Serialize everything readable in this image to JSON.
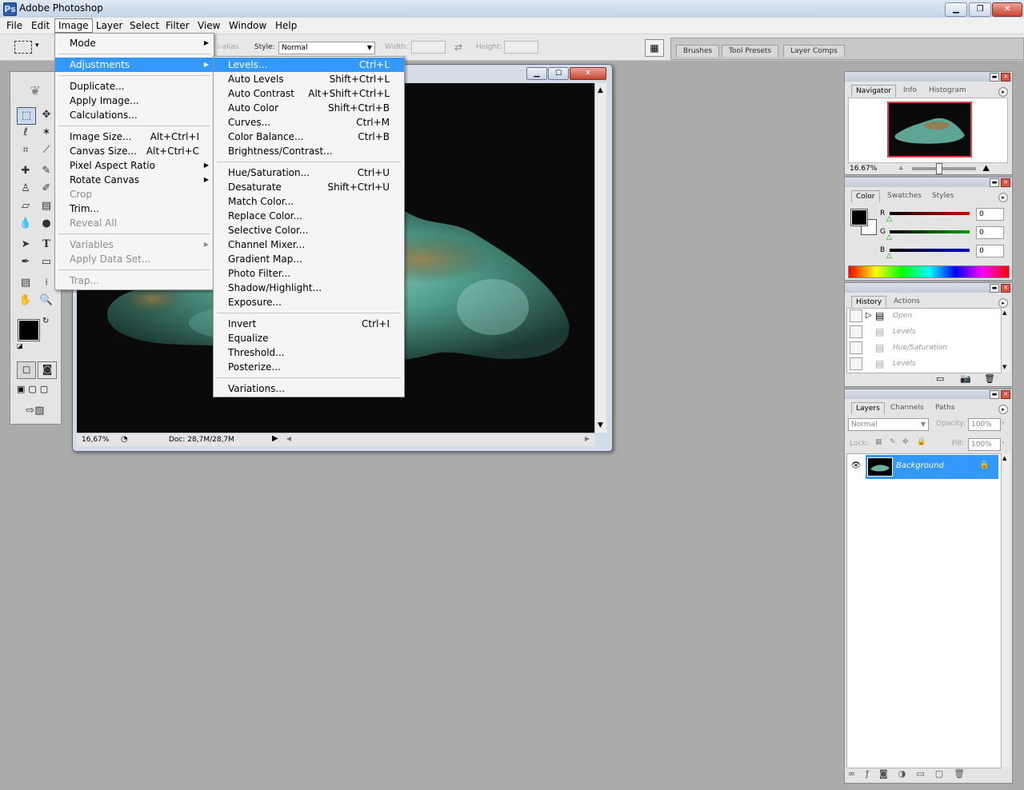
{
  "app": {
    "title": "Adobe Photoshop"
  },
  "menubar": [
    "File",
    "Edit",
    "Image",
    "Layer",
    "Select",
    "Filter",
    "View",
    "Window",
    "Help"
  ],
  "options_bar": {
    "antialias_fragment": "i-alias",
    "style_label": "Style:",
    "style_value": "Normal",
    "width_label": "Width:",
    "height_label": "Height:",
    "tabs": [
      "Brushes",
      "Tool Presets",
      "Layer Comps"
    ]
  },
  "image_menu": [
    {
      "label": "Mode",
      "shortcut": "",
      "submenu": true,
      "disabled": false
    },
    {
      "sep": true
    },
    {
      "label": "Adjustments",
      "shortcut": "",
      "submenu": true,
      "disabled": false,
      "highlight": true
    },
    {
      "sep": true
    },
    {
      "label": "Duplicate...",
      "shortcut": ""
    },
    {
      "label": "Apply Image...",
      "shortcut": ""
    },
    {
      "label": "Calculations...",
      "shortcut": ""
    },
    {
      "sep": true
    },
    {
      "label": "Image Size...",
      "shortcut": "Alt+Ctrl+I"
    },
    {
      "label": "Canvas Size...",
      "shortcut": "Alt+Ctrl+C"
    },
    {
      "label": "Pixel Aspect Ratio",
      "shortcut": "",
      "submenu": true
    },
    {
      "label": "Rotate Canvas",
      "shortcut": "",
      "submenu": true
    },
    {
      "label": "Crop",
      "shortcut": "",
      "disabled": true
    },
    {
      "label": "Trim...",
      "shortcut": ""
    },
    {
      "label": "Reveal All",
      "shortcut": "",
      "disabled": true
    },
    {
      "sep": true
    },
    {
      "label": "Variables",
      "shortcut": "",
      "submenu": true,
      "disabled": true
    },
    {
      "label": "Apply Data Set...",
      "shortcut": "",
      "disabled": true
    },
    {
      "sep": true
    },
    {
      "label": "Trap...",
      "shortcut": "",
      "disabled": true
    }
  ],
  "adjustments_menu": [
    {
      "label": "Levels...",
      "shortcut": "Ctrl+L",
      "highlight": true
    },
    {
      "label": "Auto Levels",
      "shortcut": "Shift+Ctrl+L"
    },
    {
      "label": "Auto Contrast",
      "shortcut": "Alt+Shift+Ctrl+L"
    },
    {
      "label": "Auto Color",
      "shortcut": "Shift+Ctrl+B"
    },
    {
      "label": "Curves...",
      "shortcut": "Ctrl+M"
    },
    {
      "label": "Color Balance...",
      "shortcut": "Ctrl+B"
    },
    {
      "label": "Brightness/Contrast...",
      "shortcut": ""
    },
    {
      "sep": true
    },
    {
      "label": "Hue/Saturation...",
      "shortcut": "Ctrl+U"
    },
    {
      "label": "Desaturate",
      "shortcut": "Shift+Ctrl+U"
    },
    {
      "label": "Match Color...",
      "shortcut": ""
    },
    {
      "label": "Replace Color...",
      "shortcut": ""
    },
    {
      "label": "Selective Color...",
      "shortcut": ""
    },
    {
      "label": "Channel Mixer...",
      "shortcut": ""
    },
    {
      "label": "Gradient Map...",
      "shortcut": ""
    },
    {
      "label": "Photo Filter...",
      "shortcut": ""
    },
    {
      "label": "Shadow/Highlight...",
      "shortcut": ""
    },
    {
      "label": "Exposure...",
      "shortcut": ""
    },
    {
      "sep": true
    },
    {
      "label": "Invert",
      "shortcut": "Ctrl+I"
    },
    {
      "label": "Equalize",
      "shortcut": ""
    },
    {
      "label": "Threshold...",
      "shortcut": ""
    },
    {
      "label": "Posterize...",
      "shortcut": ""
    },
    {
      "sep": true
    },
    {
      "label": "Variations...",
      "shortcut": ""
    }
  ],
  "document": {
    "zoom": "16,67%",
    "doc_info": "Doc: 28,7M/28,7M"
  },
  "navigator_panel": {
    "tabs": [
      "Navigator",
      "Info",
      "Histogram"
    ],
    "zoom": "16.67%"
  },
  "color_panel": {
    "tabs": [
      "Color",
      "Swatches",
      "Styles"
    ],
    "channels": [
      {
        "name": "R",
        "value": "0",
        "color": "#d40000"
      },
      {
        "name": "G",
        "value": "0",
        "color": "#00a000"
      },
      {
        "name": "B",
        "value": "0",
        "color": "#0000c8"
      }
    ]
  },
  "history_panel": {
    "tabs": [
      "History",
      "Actions"
    ],
    "items": [
      "Open",
      "Levels",
      "Hue/Saturation",
      "Levels"
    ]
  },
  "layers_panel": {
    "tabs": [
      "Layers",
      "Channels",
      "Paths"
    ],
    "blend_mode": "Normal",
    "opacity_label": "Opacity:",
    "opacity": "100%",
    "lock_label": "Lock:",
    "fill_label": "Fill:",
    "fill": "100%",
    "layers": [
      {
        "name": "Background"
      }
    ]
  },
  "colors": {
    "highlight": "#3399ff",
    "menu_bg": "#f5f5f5",
    "workspace": "#ababab"
  }
}
